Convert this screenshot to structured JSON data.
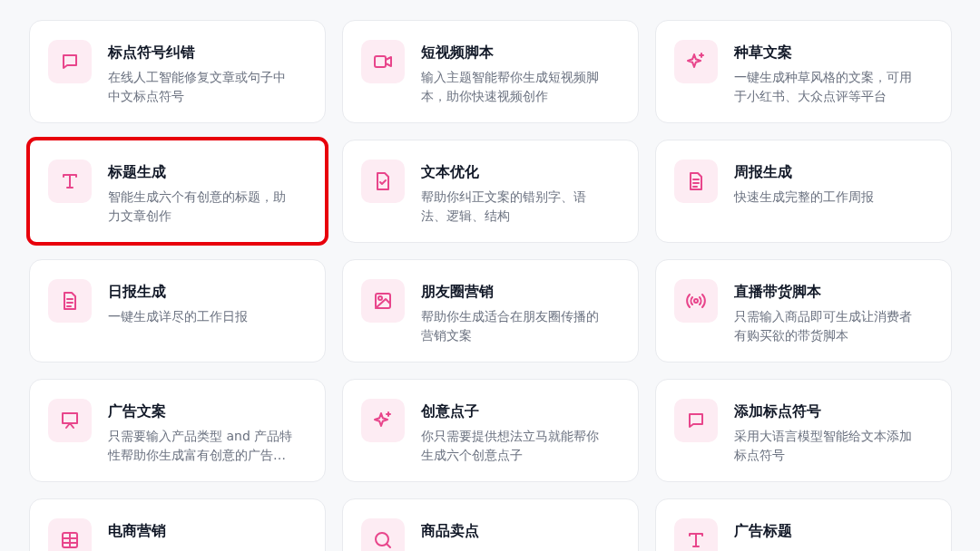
{
  "cards": [
    {
      "kind": "message",
      "title": "标点符号纠错",
      "description": "在线人工智能修复文章或句子中中文标点符号",
      "highlighted": false
    },
    {
      "kind": "video",
      "title": "短视频脚本",
      "description": "输入主题智能帮你生成短视频脚本，助你快速视频创作",
      "highlighted": false
    },
    {
      "kind": "sparkles",
      "title": "种草文案",
      "description": "一键生成种草风格的文案，可用于小红书、大众点评等平台",
      "highlighted": false
    },
    {
      "kind": "type",
      "title": "标题生成",
      "description": "智能生成六个有创意的标题，助力文章创作",
      "highlighted": true
    },
    {
      "kind": "file-check",
      "title": "文本优化",
      "description": "帮助你纠正文案的错别字、语法、逻辑、结构",
      "highlighted": false
    },
    {
      "kind": "file-text",
      "title": "周报生成",
      "description": "快速生成完整的工作周报",
      "highlighted": false
    },
    {
      "kind": "file-text",
      "title": "日报生成",
      "description": "一键生成详尽的工作日报",
      "highlighted": false
    },
    {
      "kind": "image",
      "title": "朋友圈营销",
      "description": "帮助你生成适合在朋友圈传播的营销文案",
      "highlighted": false
    },
    {
      "kind": "broadcast",
      "title": "直播带货脚本",
      "description": "只需输入商品即可生成让消费者有购买欲的带货脚本",
      "highlighted": false
    },
    {
      "kind": "presentation",
      "title": "广告文案",
      "description": "只需要输入产品类型 and 产品特性帮助你生成富有创意的广告…",
      "highlighted": false
    },
    {
      "kind": "sparkles",
      "title": "创意点子",
      "description": "你只需要提供想法立马就能帮你生成六个创意点子",
      "highlighted": false
    },
    {
      "kind": "message",
      "title": "添加标点符号",
      "description": "采用大语言模型智能给文本添加标点符号",
      "highlighted": false
    },
    {
      "kind": "table",
      "title": "电商营销",
      "highlighted": false
    },
    {
      "kind": "search",
      "title": "商品卖点",
      "highlighted": false
    },
    {
      "kind": "type",
      "title": "广告标题",
      "highlighted": false
    }
  ]
}
